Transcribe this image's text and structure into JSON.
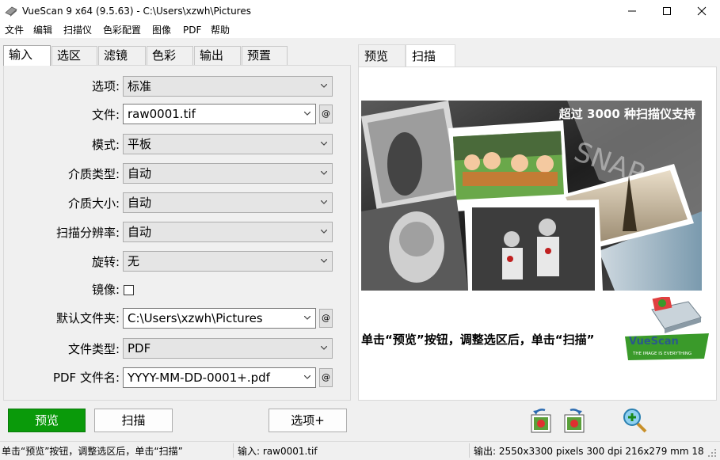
{
  "window": {
    "title": "VueScan 9 x64 (9.5.63) - C:\\Users\\xzwh\\Pictures"
  },
  "menu": [
    "文件",
    "编辑",
    "扫描仪",
    "色彩配置",
    "图像",
    "PDF",
    "帮助"
  ],
  "left_tabs": [
    "输入",
    "选区",
    "滤镜",
    "色彩",
    "输出",
    "预置"
  ],
  "input_panel": {
    "options_label": "选项:",
    "options_value": "标准",
    "file_label": "文件:",
    "file_value": "raw0001.tif",
    "mode_label": "模式:",
    "mode_value": "平板",
    "media_type_label": "介质类型:",
    "media_type_value": "自动",
    "media_size_label": "介质大小:",
    "media_size_value": "自动",
    "resolution_label": "扫描分辨率:",
    "resolution_value": "自动",
    "rotate_label": "旋转:",
    "rotate_value": "无",
    "mirror_label": "镜像:",
    "default_folder_label": "默认文件夹:",
    "default_folder_value": "C:\\Users\\xzwh\\Pictures",
    "file_type_label": "文件类型:",
    "file_type_value": "PDF",
    "pdf_name_label": "PDF 文件名:",
    "pdf_name_value": "YYYY-MM-DD-0001+.pdf",
    "at_label": "@"
  },
  "right_tabs": [
    "预览",
    "扫描"
  ],
  "preview": {
    "banner": "超过 3000 种扫描仪支持",
    "caption": "单击“预览”按钮，调整选区后，单击“扫描”",
    "logo_text": "VueScan",
    "logo_tagline": "THE IMAGE IS EVERYTHING"
  },
  "buttons": {
    "preview": "预览",
    "scan": "扫描",
    "options": "选项+"
  },
  "status": {
    "left": "单击“预览”按钮，调整选区后，单击“扫描”",
    "middle": "输入: raw0001.tif",
    "right": "输出: 2550x3300 pixels 300 dpi 216x279 mm 18...."
  },
  "colors": {
    "preview_button": "#0a9a0a",
    "window_bg": "#f0f0f0",
    "accent_green": "#3a9a2a"
  }
}
